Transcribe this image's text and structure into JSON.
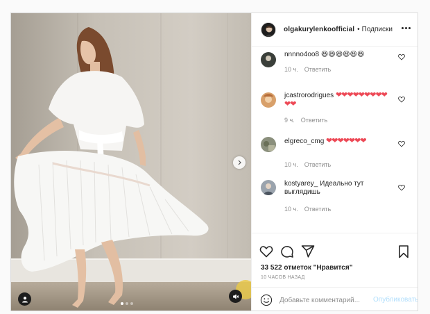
{
  "post": {
    "username": "olgakurylenkoofficial",
    "separator": "•",
    "follow_label": "Подписки",
    "more_icon": "more-horizontal-icon",
    "carousel": {
      "slide_count": 3,
      "active_index": 0
    }
  },
  "comments": [
    {
      "user": "nnnno4oo8",
      "text": "😆😆😆😆😆😆",
      "time": "10 ч.",
      "reply_label": "Ответить"
    },
    {
      "user": "jcastrorodrigues",
      "text": "❤❤❤❤❤❤❤❤❤❤❤",
      "time": "9 ч.",
      "reply_label": "Ответить"
    },
    {
      "user": "elgreco_cmg",
      "text": "❤❤❤❤❤❤❤",
      "time": "10 ч.",
      "reply_label": "Ответить"
    },
    {
      "user": "kostyarey_",
      "text": "Идеально тут выглядишь",
      "time": "10 ч.",
      "reply_label": "Ответить"
    }
  ],
  "actions": {
    "likes_text": "33 522 отметок \"Нравится\"",
    "time_ago": "10 ЧАСОВ НАЗАД"
  },
  "composer": {
    "placeholder": "Добавьте комментарий...",
    "publish_label": "Опубликовать"
  },
  "colors": {
    "heart": "#ed4956",
    "link_disabled": "#b2dffc",
    "secondary_text": "#8e8e8e",
    "border": "#dbdbdb"
  }
}
